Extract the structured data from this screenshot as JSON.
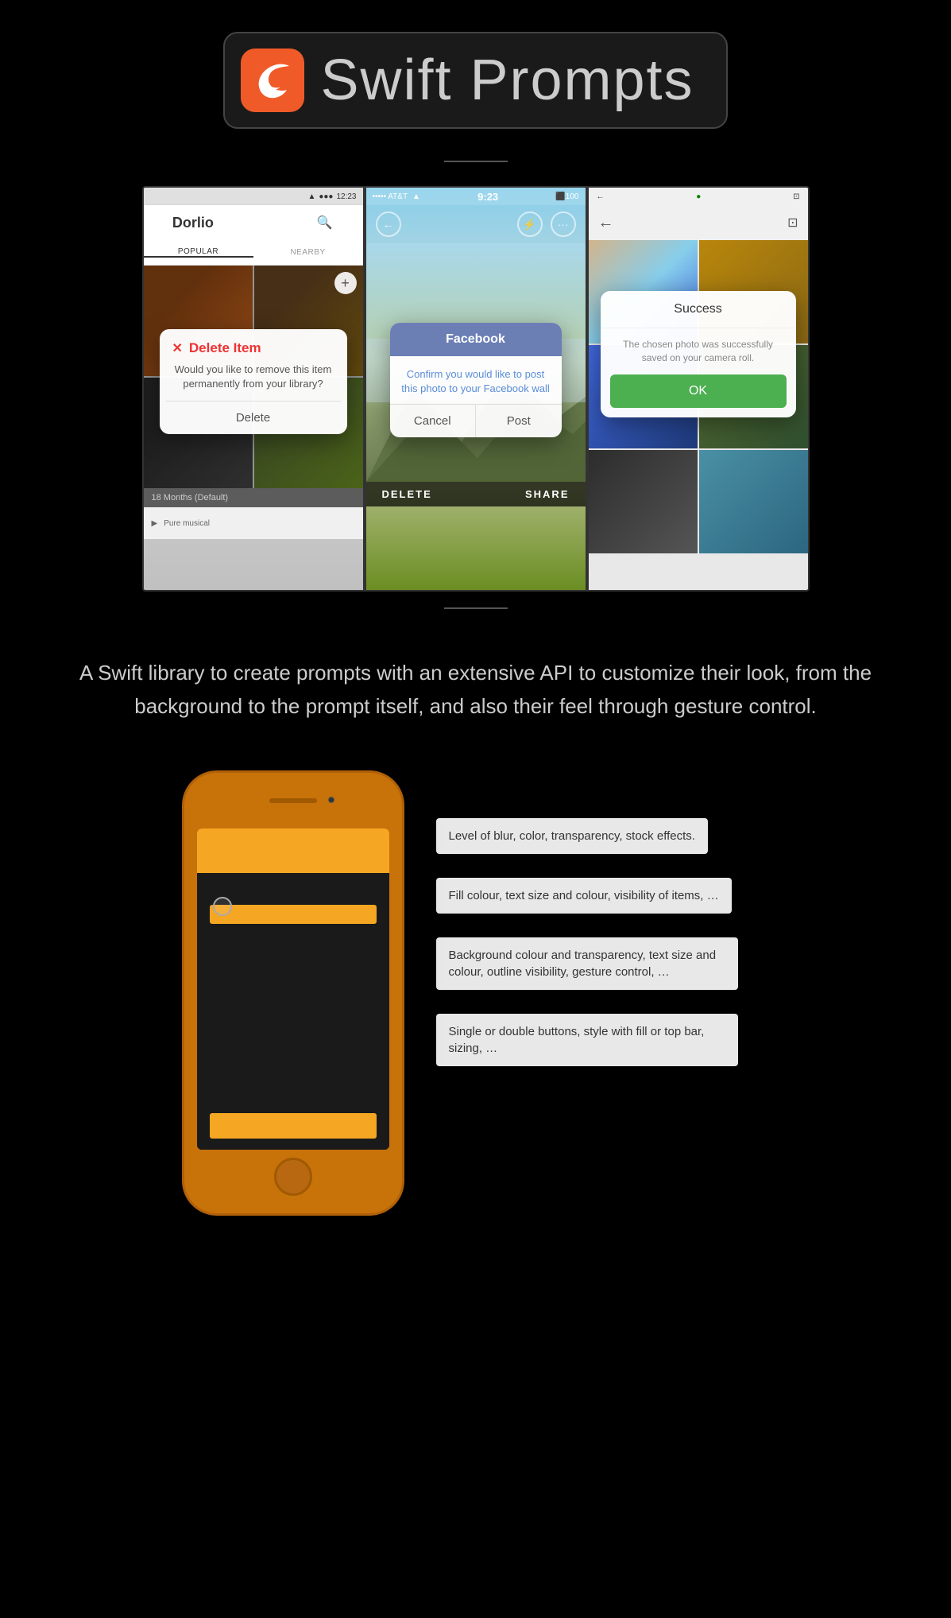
{
  "header": {
    "title": "Swift Prompts",
    "logo_alt": "Swift logo"
  },
  "screenshots": [
    {
      "id": "screen1",
      "status_time": "12:23",
      "app_name": "Dorlio",
      "tabs": [
        "POPULAR",
        "NEARBY"
      ],
      "alert": {
        "icon": "✕",
        "title": "Delete Item",
        "body": "Would you like to remove this item permanently from your library?",
        "button": "Delete"
      },
      "footer_label": "18 Months (Default)"
    },
    {
      "id": "screen2",
      "status_carrier": "••••• AT&T",
      "status_time": "9:23",
      "status_battery": "100",
      "alert": {
        "title": "Facebook",
        "body": "Confirm you would like to post this photo to your Facebook wall",
        "cancel": "Cancel",
        "confirm": "Post"
      },
      "footer_delete": "DELETE",
      "footer_share": "SHARE"
    },
    {
      "id": "screen3",
      "alert": {
        "title": "Success",
        "body": "The chosen photo was successfully saved on your camera roll.",
        "button": "OK"
      }
    }
  ],
  "description": "A Swift library to create prompts with an extensive API to customize their look, from the background to the prompt itself, and also their feel through gesture control.",
  "annotations": [
    {
      "id": "annotation1",
      "text": "Level of blur, color, transparency, stock effects."
    },
    {
      "id": "annotation2",
      "text": "Fill colour, text size and colour, visibility of items, …"
    },
    {
      "id": "annotation3",
      "text": "Background colour and transparency, text size and colour, outline visibility, gesture control, …"
    },
    {
      "id": "annotation4",
      "text": "Single or double buttons, style with fill or top bar, sizing, …"
    }
  ]
}
